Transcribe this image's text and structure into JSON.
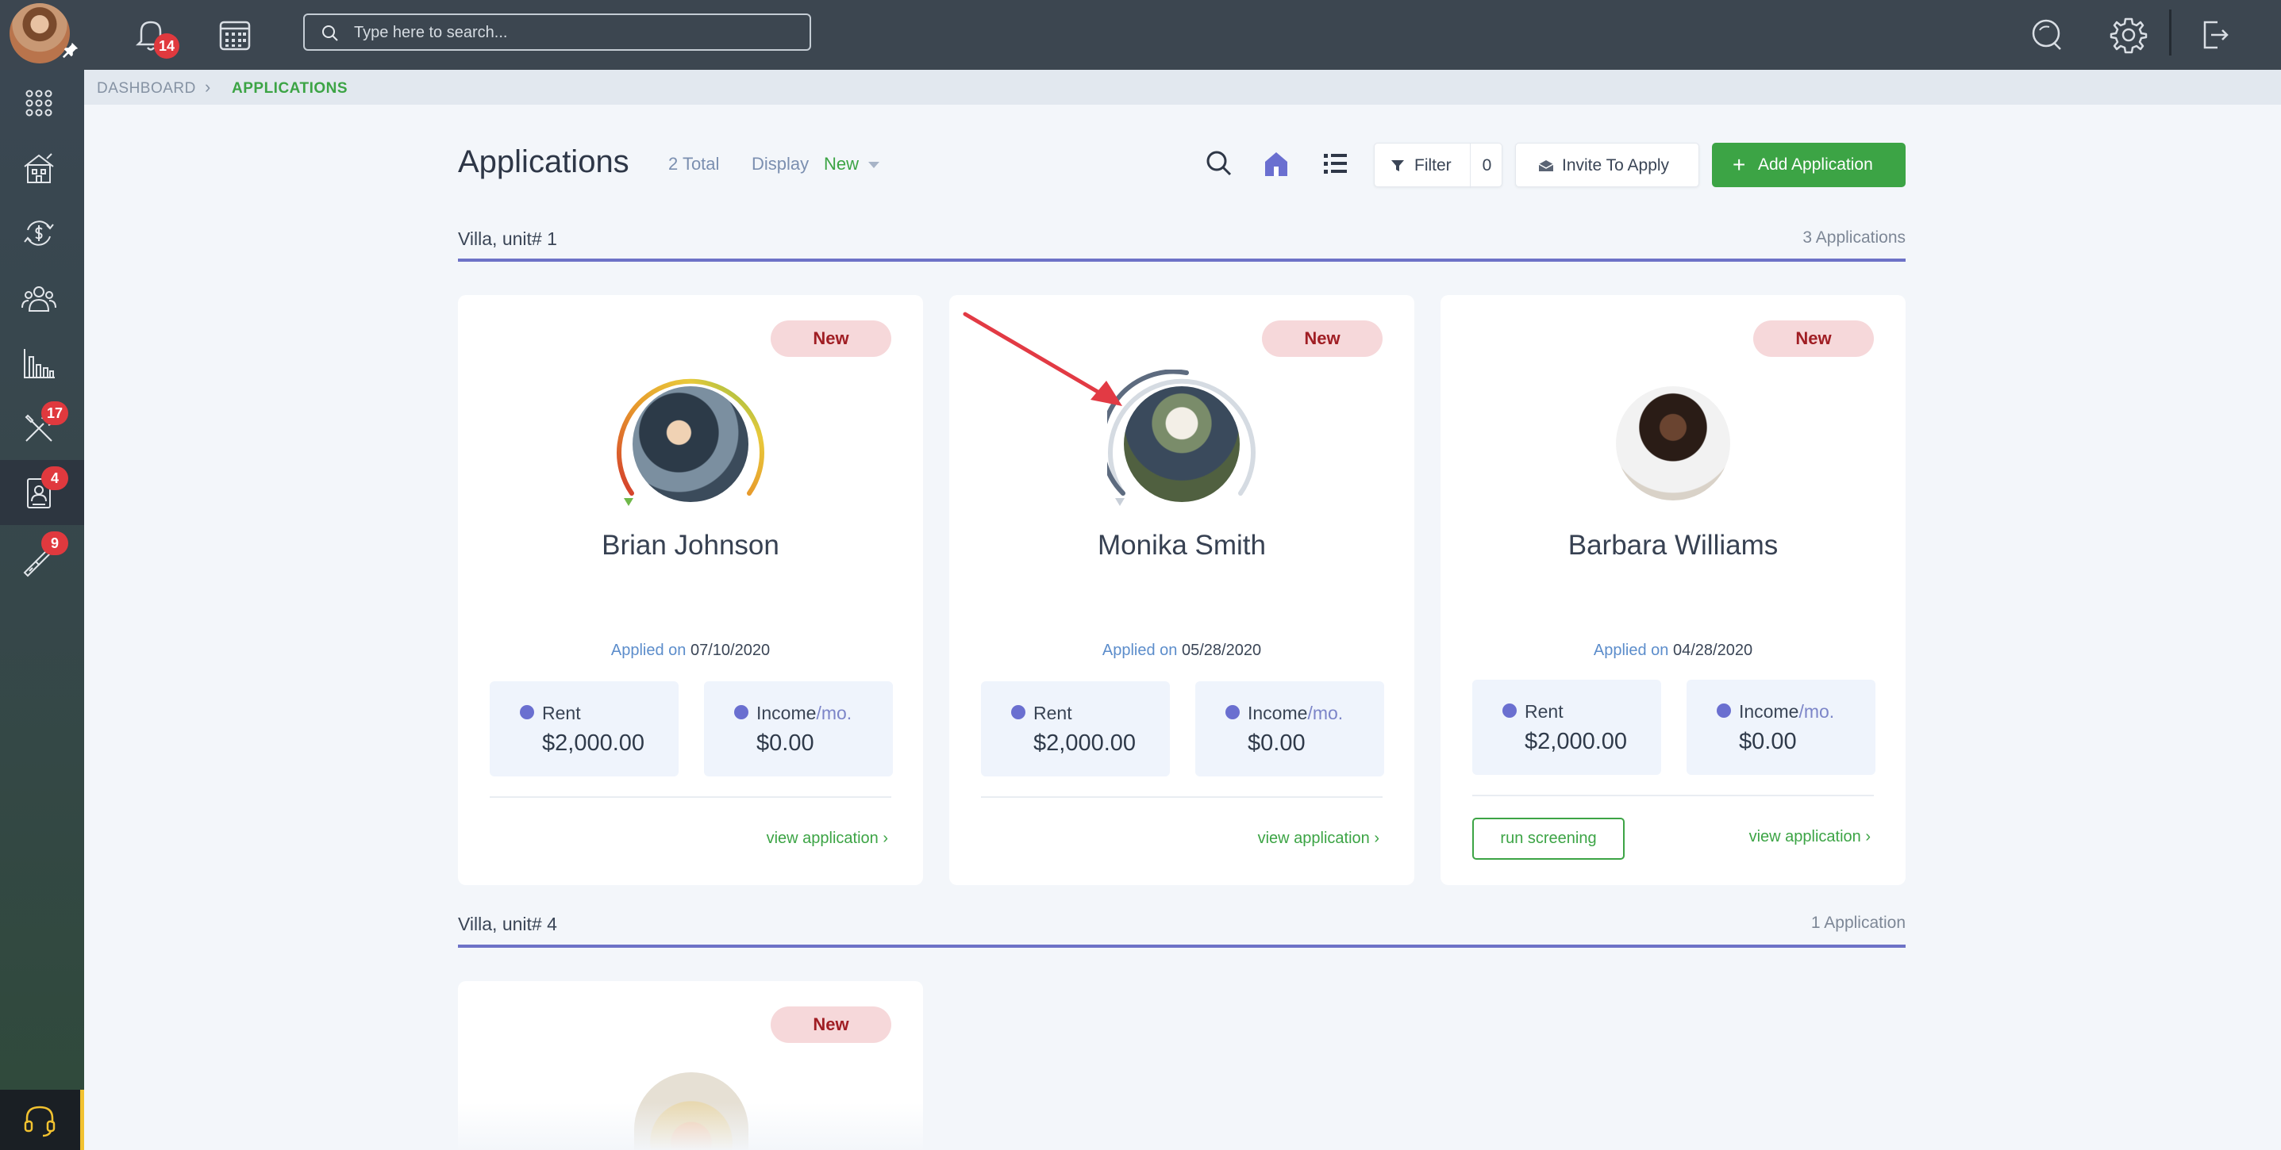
{
  "topbar": {
    "notifications_count": "14",
    "search_placeholder": "Type here to search..."
  },
  "sidebar": {
    "badges": {
      "maintenance": "17",
      "applications": "4",
      "tools": "9"
    }
  },
  "breadcrumb": {
    "root": "DASHBOARD",
    "current": "APPLICATIONS"
  },
  "header": {
    "title": "Applications",
    "total": "2 Total",
    "display_label": "Display",
    "display_value": "New",
    "filter_label": "Filter",
    "filter_count": "0",
    "invite_label": "Invite To Apply",
    "add_label": "Add Application"
  },
  "sections": [
    {
      "title": "Villa, unit# 1",
      "count": "3 Applications",
      "cards": [
        {
          "status": "New",
          "name": "Brian Johnson",
          "applied_label": "Applied on",
          "applied_date": "07/10/2020",
          "rent_label": "Rent",
          "rent": "$2,000.00",
          "income_label": "Income",
          "income_unit": "/mo.",
          "income": "$0.00",
          "view": "view application"
        },
        {
          "status": "New",
          "name": "Monika Smith",
          "applied_label": "Applied on",
          "applied_date": "05/28/2020",
          "rent_label": "Rent",
          "rent": "$2,000.00",
          "income_label": "Income",
          "income_unit": "/mo.",
          "income": "$0.00",
          "view": "view application"
        },
        {
          "status": "New",
          "name": "Barbara Williams",
          "applied_label": "Applied on",
          "applied_date": "04/28/2020",
          "rent_label": "Rent",
          "rent": "$2,000.00",
          "income_label": "Income",
          "income_unit": "/mo.",
          "income": "$0.00",
          "run": "run screening",
          "view": "view application"
        }
      ]
    },
    {
      "title": "Villa, unit# 4",
      "count": "1 Application",
      "cards": [
        {
          "status": "New"
        }
      ]
    }
  ],
  "colors": {
    "accent_green": "#3ca445",
    "badge_red": "#e0393e",
    "section_line": "#6d72c7",
    "topbar": "#3c4650"
  }
}
